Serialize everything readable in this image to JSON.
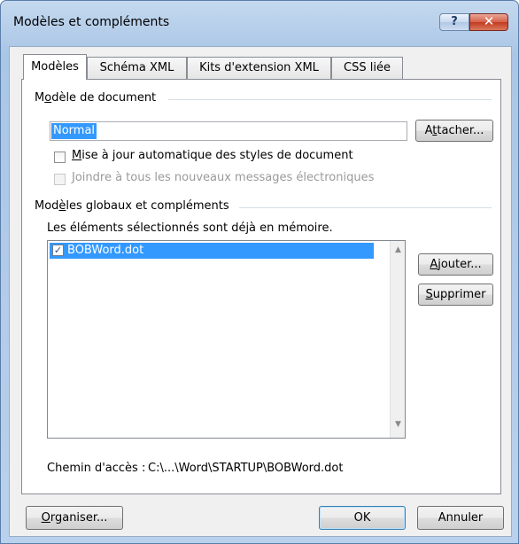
{
  "window": {
    "title": "Modèles et compléments",
    "help_glyph": "?",
    "close_glyph": "✕"
  },
  "tabs": [
    {
      "label": "Modèles",
      "active": true
    },
    {
      "label": "Schéma XML",
      "active": false
    },
    {
      "label": "Kits d'extension XML",
      "active": false
    },
    {
      "label": "CSS liée",
      "active": false
    }
  ],
  "document_template": {
    "group_label_pre": "M",
    "group_label_u": "o",
    "group_label_post": "dèle de document",
    "value": "Normal",
    "attach_button": {
      "pre": "A",
      "u": "t",
      "post": "tacher..."
    },
    "auto_update": {
      "label_pre": "",
      "label_u": "M",
      "label_post": "ise à jour automatique des styles de document",
      "checked": false
    },
    "attach_to_mail": {
      "label": "Joindre à tous les nouveaux messages électroniques",
      "checked": false,
      "disabled": true
    }
  },
  "global_templates": {
    "group_label_pre": "Mod",
    "group_label_u": "è",
    "group_label_post": "les globaux et compléments",
    "hint": "Les éléments sélectionnés sont déjà en mémoire.",
    "items": [
      {
        "label": "BOBWord.dot",
        "checked": true,
        "selected": true
      }
    ],
    "add_button": {
      "pre": "",
      "u": "A",
      "post": "jouter..."
    },
    "remove_button": {
      "pre": "",
      "u": "S",
      "post": "upprimer"
    }
  },
  "path": {
    "label": "Chemin d'accès :",
    "value": "C:\\...\\Word\\STARTUP\\BOBWord.dot"
  },
  "footer": {
    "organize_button": {
      "pre": "",
      "u": "O",
      "post": "rganiser..."
    },
    "ok_button": "OK",
    "cancel_button": "Annuler"
  },
  "colors": {
    "selection": "#3399ff",
    "close_button": "#c33b21",
    "frame": "#b7cfea"
  },
  "icons": {
    "scroll_up": "▲",
    "scroll_down": "▼",
    "check": "✓"
  }
}
